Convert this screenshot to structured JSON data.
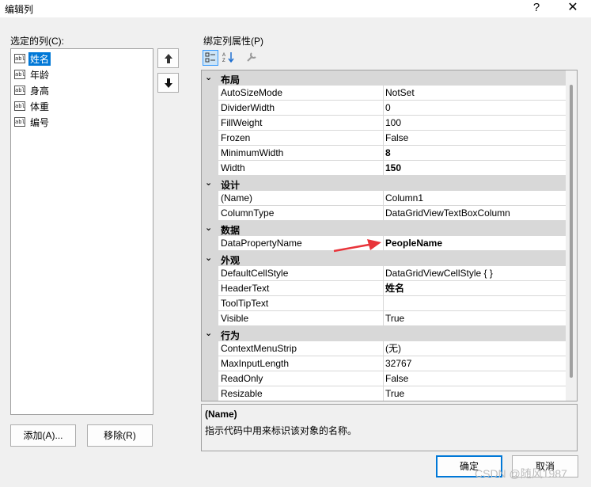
{
  "window": {
    "title": "编辑列",
    "help": "?",
    "close": "✕"
  },
  "left": {
    "label": "选定的列(C):",
    "columns": [
      {
        "icon": "abl",
        "label": "姓名",
        "selected": true
      },
      {
        "icon": "abl",
        "label": "年龄"
      },
      {
        "icon": "abl",
        "label": "身高"
      },
      {
        "icon": "abl",
        "label": "体重"
      },
      {
        "icon": "abl",
        "label": "编号"
      }
    ],
    "move_up": "🡅",
    "move_down": "🡇",
    "add_label": "添加(A)...",
    "remove_label": "移除(R)"
  },
  "right": {
    "label": "绑定列属性(P)",
    "toolbar": [
      "categorized-icon",
      "alphabetical-icon",
      "property-pages-icon"
    ],
    "categories": [
      {
        "name": "布局",
        "props": [
          {
            "name": "AutoSizeMode",
            "value": "NotSet"
          },
          {
            "name": "DividerWidth",
            "value": "0"
          },
          {
            "name": "FillWeight",
            "value": "100"
          },
          {
            "name": "Frozen",
            "value": "False"
          },
          {
            "name": "MinimumWidth",
            "value": "8",
            "bold": true
          },
          {
            "name": "Width",
            "value": "150",
            "bold": true
          }
        ]
      },
      {
        "name": "设计",
        "props": [
          {
            "name": "(Name)",
            "value": "Column1"
          },
          {
            "name": "ColumnType",
            "value": "DataGridViewTextBoxColumn"
          }
        ]
      },
      {
        "name": "数据",
        "props": [
          {
            "name": "DataPropertyName",
            "value": "PeopleName",
            "bold": true
          }
        ]
      },
      {
        "name": "外观",
        "props": [
          {
            "name": "DefaultCellStyle",
            "value": "DataGridViewCellStyle { }"
          },
          {
            "name": "HeaderText",
            "value": "姓名",
            "bold": true
          },
          {
            "name": "ToolTipText",
            "value": ""
          },
          {
            "name": "Visible",
            "value": "True"
          }
        ]
      },
      {
        "name": "行为",
        "props": [
          {
            "name": "ContextMenuStrip",
            "value": "(无)"
          },
          {
            "name": "MaxInputLength",
            "value": "32767"
          },
          {
            "name": "ReadOnly",
            "value": "False"
          },
          {
            "name": "Resizable",
            "value": "True"
          }
        ]
      }
    ],
    "description": {
      "title": "(Name)",
      "text": "指示代码中用来标识该对象的名称。"
    }
  },
  "buttons": {
    "ok": "确定",
    "cancel": "取消"
  },
  "watermark": "CSDN @随风1987",
  "colors": {
    "selection": "#0078d7",
    "category_bg": "#d8d8d8",
    "arrow": "#e8343a"
  }
}
